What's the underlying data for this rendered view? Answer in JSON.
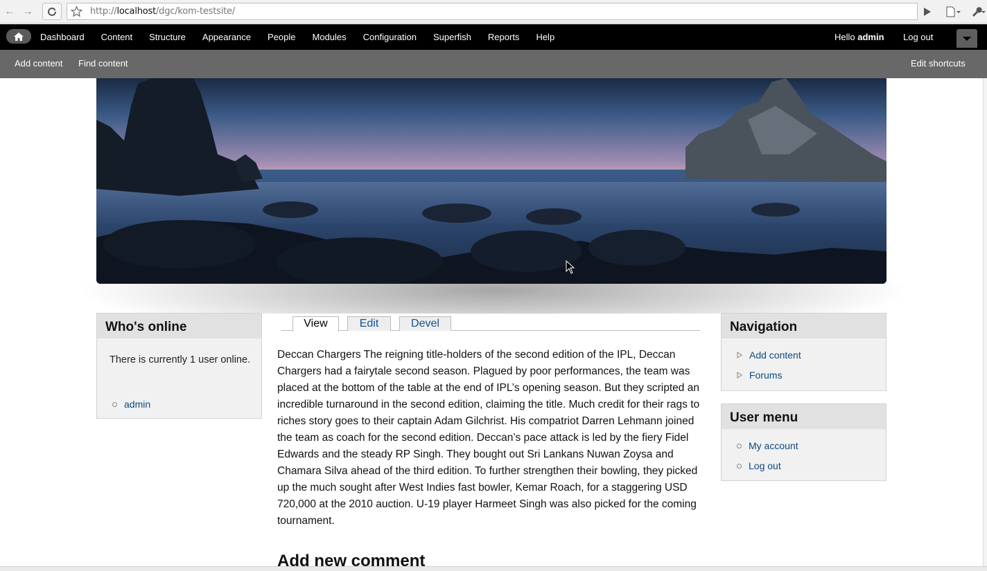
{
  "browser": {
    "url_prefix": "http://",
    "url_host": "localhost",
    "url_path": "/dgc/kom-testsite/"
  },
  "admin_toolbar": {
    "menu": [
      "Dashboard",
      "Content",
      "Structure",
      "Appearance",
      "People",
      "Modules",
      "Configuration",
      "Superfish",
      "Reports",
      "Help"
    ],
    "greeting": "Hello",
    "username": "admin",
    "logout": "Log out"
  },
  "shortcuts": {
    "add_content": "Add content",
    "find_content": "Find content",
    "edit_shortcuts": "Edit shortcuts"
  },
  "whos_online": {
    "title": "Who's online",
    "text": "There is currently 1 user online.",
    "users": [
      "admin"
    ]
  },
  "tabs": [
    "View",
    "Edit",
    "Devel"
  ],
  "article": {
    "body": "Deccan Chargers The reigning title-holders of the second edition of the IPL, Deccan Chargers had a fairytale second season. Plagued by poor performances, the team was placed at the bottom of the table at the end of IPL’s opening season. But they scripted an incredible turnaround in the second edition, claiming the title. Much credit for their rags to riches story goes to their captain Adam Gilchrist. His compatriot Darren Lehmann joined the team as coach for the second edition. Deccan’s pace attack is led by the fiery Fidel Edwards and the steady RP Singh. They bought out Sri Lankans Nuwan Zoysa and Chamara Silva ahead of the third edition. To further strengthen their bowling, they picked up the much sought after West Indies fast bowler, Kemar Roach, for a staggering USD 720,000 at the 2010 auction. U-19 player Harmeet Singh was also picked for the coming tournament.",
    "comment_heading": "Add new comment"
  },
  "navigation": {
    "title": "Navigation",
    "items": [
      "Add content",
      "Forums"
    ]
  },
  "user_menu": {
    "title": "User menu",
    "items": [
      "My account",
      "Log out"
    ]
  }
}
